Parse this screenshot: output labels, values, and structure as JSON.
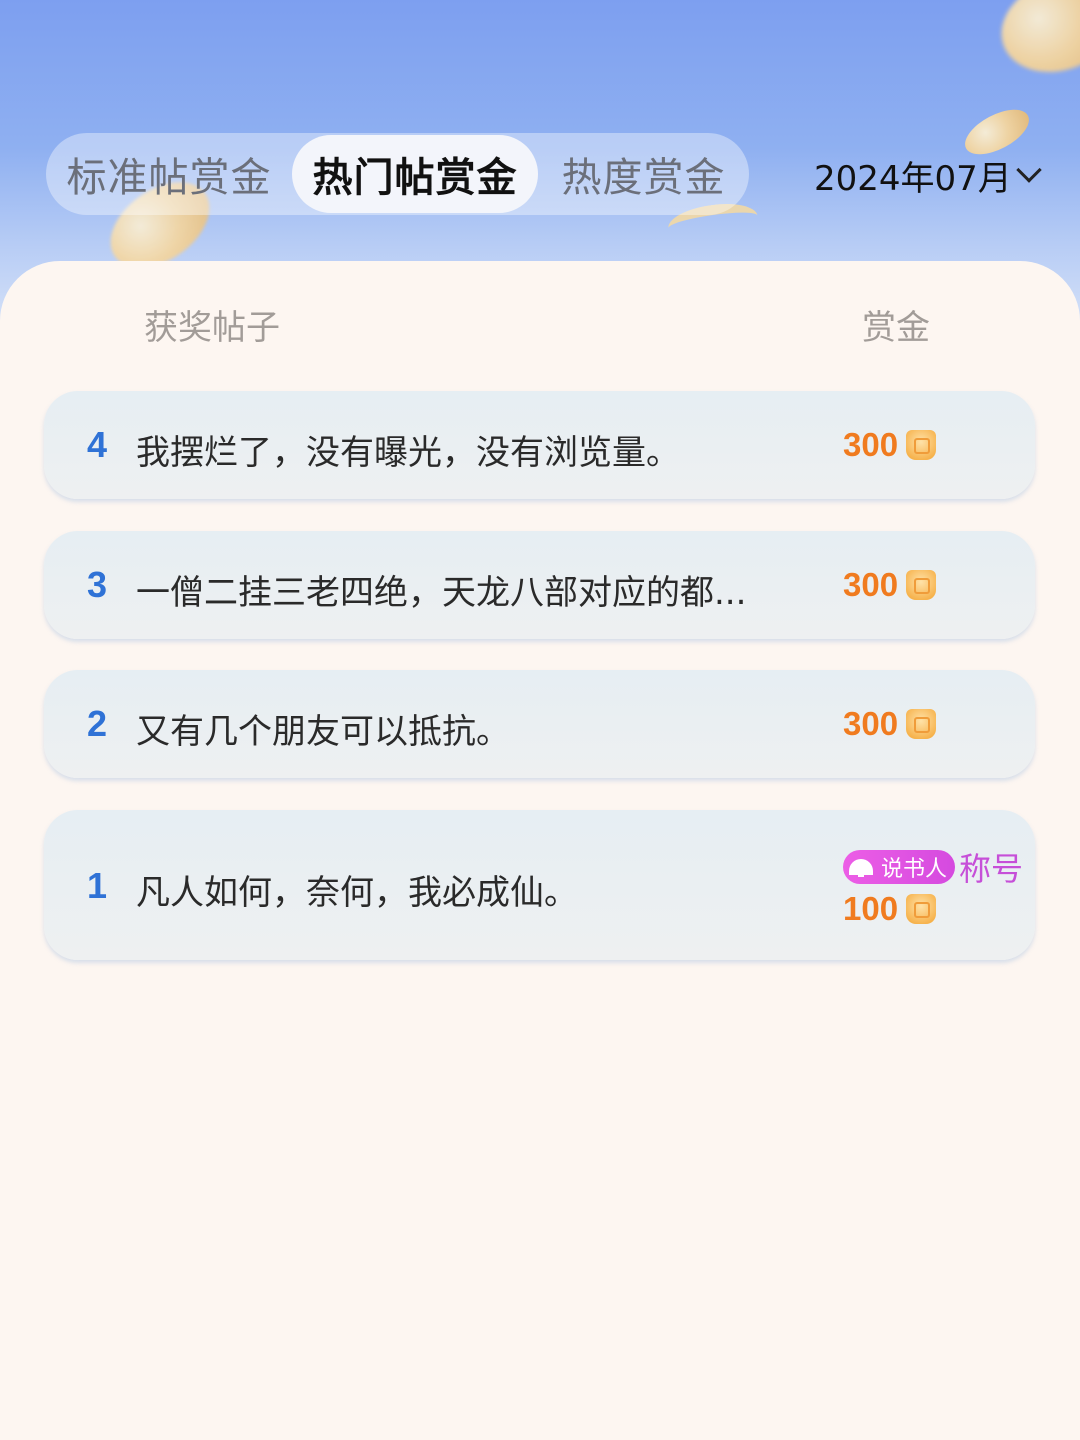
{
  "tabs": [
    {
      "label": "标准帖赏金",
      "active": false
    },
    {
      "label": "热门帖赏金",
      "active": true
    },
    {
      "label": "热度赏金",
      "active": false
    }
  ],
  "month_selector": {
    "label": "2024年07月",
    "icon": "chevron-down-icon"
  },
  "columns": {
    "post": "获奖帖子",
    "reward": "赏金"
  },
  "rows": [
    {
      "rank": "4",
      "title": "我摆烂了，没有曝光，没有浏览量。",
      "reward": "300",
      "icon": "gift-coin-icon"
    },
    {
      "rank": "3",
      "title": "一僧二挂三老四绝，天龙八部对应的都...",
      "reward": "300",
      "icon": "gift-coin-icon"
    },
    {
      "rank": "2",
      "title": "又有几个朋友可以抵抗。",
      "reward": "300",
      "icon": "gift-coin-icon"
    },
    {
      "rank": "1",
      "title": "凡人如何，奈何，我必成仙。",
      "reward": "100",
      "icon": "gift-coin-icon",
      "badge": {
        "label": "说书人",
        "suffix": "称号",
        "icon": "fan-icon"
      }
    }
  ],
  "colors": {
    "accent_rank": "#2f72d6",
    "reward": "#f07b1f",
    "badge": "#d54adf"
  }
}
